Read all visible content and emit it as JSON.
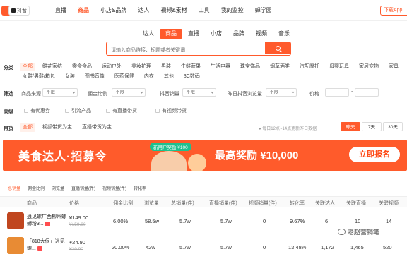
{
  "topbar": {
    "platform": "抖音",
    "nav": [
      "直播",
      "商品",
      "小店&品牌",
      "达人",
      "视频&素材",
      "工具",
      "我的监控",
      "蝉学园"
    ],
    "active_index": 1,
    "download": "下载App"
  },
  "category_tabs": {
    "items": [
      "达人",
      "商品",
      "直播",
      "小店",
      "品牌",
      "视频",
      "音乐"
    ],
    "active_index": 1
  },
  "search": {
    "placeholder": "请输入商品链接、标题或者关键词"
  },
  "filters": {
    "category_label": "分类",
    "categories_row1": [
      "全部",
      "鲜花家纺",
      "零食食品",
      "运动户外",
      "美妆护理",
      "男装",
      "生鲜蔬果",
      "生活电器",
      "珠宝饰品",
      "烟草酒类",
      "汽配摩托",
      "母婴玩具",
      "家居宠物",
      "家具"
    ],
    "categories_row2": [
      "女鞋/男鞋/箱包",
      "女装",
      "图书音像",
      "医药保健",
      "内衣",
      "其他",
      "3C数码"
    ],
    "screen_label": "筛选",
    "screen_items": [
      {
        "label": "商品来源",
        "value": "不限"
      },
      {
        "label": "佣金比例",
        "value": "不限"
      },
      {
        "label": "抖音销量",
        "value": "不限"
      },
      {
        "label": "昨日抖音浏览量",
        "value": "不限"
      },
      {
        "label": "价格",
        "value": ""
      }
    ],
    "advanced_label": "高级",
    "advanced_items": [
      "有优惠券",
      "引流产品",
      "有直播带货",
      "有视频带货"
    ],
    "carry_label": "带货",
    "carry_items": [
      "全部",
      "视频带货为主",
      "直播带货为主"
    ],
    "update_note": "每日12点~14点更新昨日数据",
    "day_buttons": [
      "昨天",
      "7天",
      "30天"
    ],
    "active_day": 0
  },
  "banner": {
    "title": "美食达人·招募令",
    "pill": "新用户奖励 ¥100",
    "reward": "最高奖励 ¥10,000",
    "cta": "立即报名"
  },
  "sort_tabs": [
    "总销量",
    "佣金比例",
    "浏览量",
    "直播销量(件)",
    "视频销量(件)",
    "转化率"
  ],
  "table": {
    "headers": [
      "商品",
      "价格",
      "佣金比例",
      "浏览量",
      "总销量(件)",
      "直播销量(件)",
      "视频销量(件)",
      "转化率",
      "关联达人",
      "关联直播",
      "关联视频"
    ],
    "rows": [
      {
        "name": "逍见螺广西柳州螺蛳粉3...",
        "price": "¥149.00",
        "orig": "¥159.00",
        "commission": "6.00%",
        "views": "58.5w",
        "total": "5.7w",
        "live": "5.7w",
        "video": "0",
        "rate": "9.67%",
        "talent": "6",
        "lives": "10",
        "videos": "14"
      },
      {
        "name": "「818大促」逍见螺...",
        "price": "¥24.90",
        "orig": "¥39.90",
        "commission": "20.00%",
        "views": "42w",
        "total": "5.7w",
        "live": "5.7w",
        "video": "0",
        "rate": "13.48%",
        "talent": "1,172",
        "lives": "1,465",
        "videos": "520"
      }
    ]
  },
  "watermark": "老赵营销笔"
}
